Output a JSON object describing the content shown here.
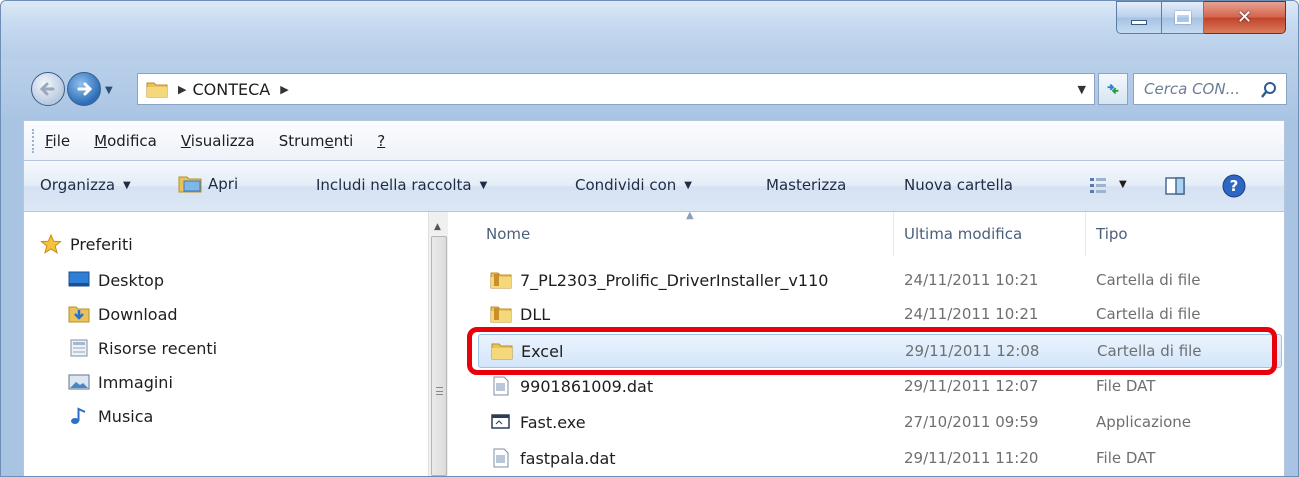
{
  "window": {
    "colors": {
      "accent": "#2c6db6",
      "highlight": "#e8000a",
      "selection": "#d3e6fa"
    }
  },
  "address": {
    "path": [
      "CONTECA"
    ],
    "search_placeholder": "Cerca CON..."
  },
  "menubar": {
    "items": [
      {
        "label": "File",
        "mnemonic": "F"
      },
      {
        "label": "Modifica",
        "mnemonic": "M"
      },
      {
        "label": "Visualizza",
        "mnemonic": "V"
      },
      {
        "label": "Strumenti",
        "mnemonic": "e"
      },
      {
        "label": "?",
        "mnemonic": "?"
      }
    ]
  },
  "toolbar": {
    "organize": "Organizza",
    "open": "Apri",
    "include": "Includi nella raccolta",
    "share": "Condividi con",
    "burn": "Masterizza",
    "new_folder": "Nuova cartella"
  },
  "navpane": {
    "favorites": "Preferiti",
    "items": [
      {
        "label": "Desktop",
        "icon": "desktop-icon"
      },
      {
        "label": "Download",
        "icon": "download-folder-icon"
      },
      {
        "label": "Risorse recenti",
        "icon": "recent-places-icon"
      },
      {
        "label": "Immagini",
        "icon": "pictures-icon"
      },
      {
        "label": "Musica",
        "icon": "music-icon"
      }
    ]
  },
  "files": {
    "columns": {
      "name": "Nome",
      "date": "Ultima modifica",
      "type": "Tipo"
    },
    "rows": [
      {
        "name": "7_PL2303_Prolific_DriverInstaller_v110",
        "date": "24/11/2011 10:21",
        "type": "Cartella di file",
        "icon": "folder-icon"
      },
      {
        "name": "DLL",
        "date": "24/11/2011 10:21",
        "type": "Cartella di file",
        "icon": "folder-icon"
      },
      {
        "name": "Excel",
        "date": "29/11/2011 12:08",
        "type": "Cartella di file",
        "icon": "folder-icon",
        "selected": true
      },
      {
        "name": "9901861009.dat",
        "date": "29/11/2011 12:07",
        "type": "File DAT",
        "icon": "dat-file-icon"
      },
      {
        "name": "Fast.exe",
        "date": "27/10/2011 09:59",
        "type": "Applicazione",
        "icon": "exe-file-icon"
      },
      {
        "name": "fastpala.dat",
        "date": "29/11/2011 11:20",
        "type": "File DAT",
        "icon": "dat-file-icon"
      }
    ]
  }
}
